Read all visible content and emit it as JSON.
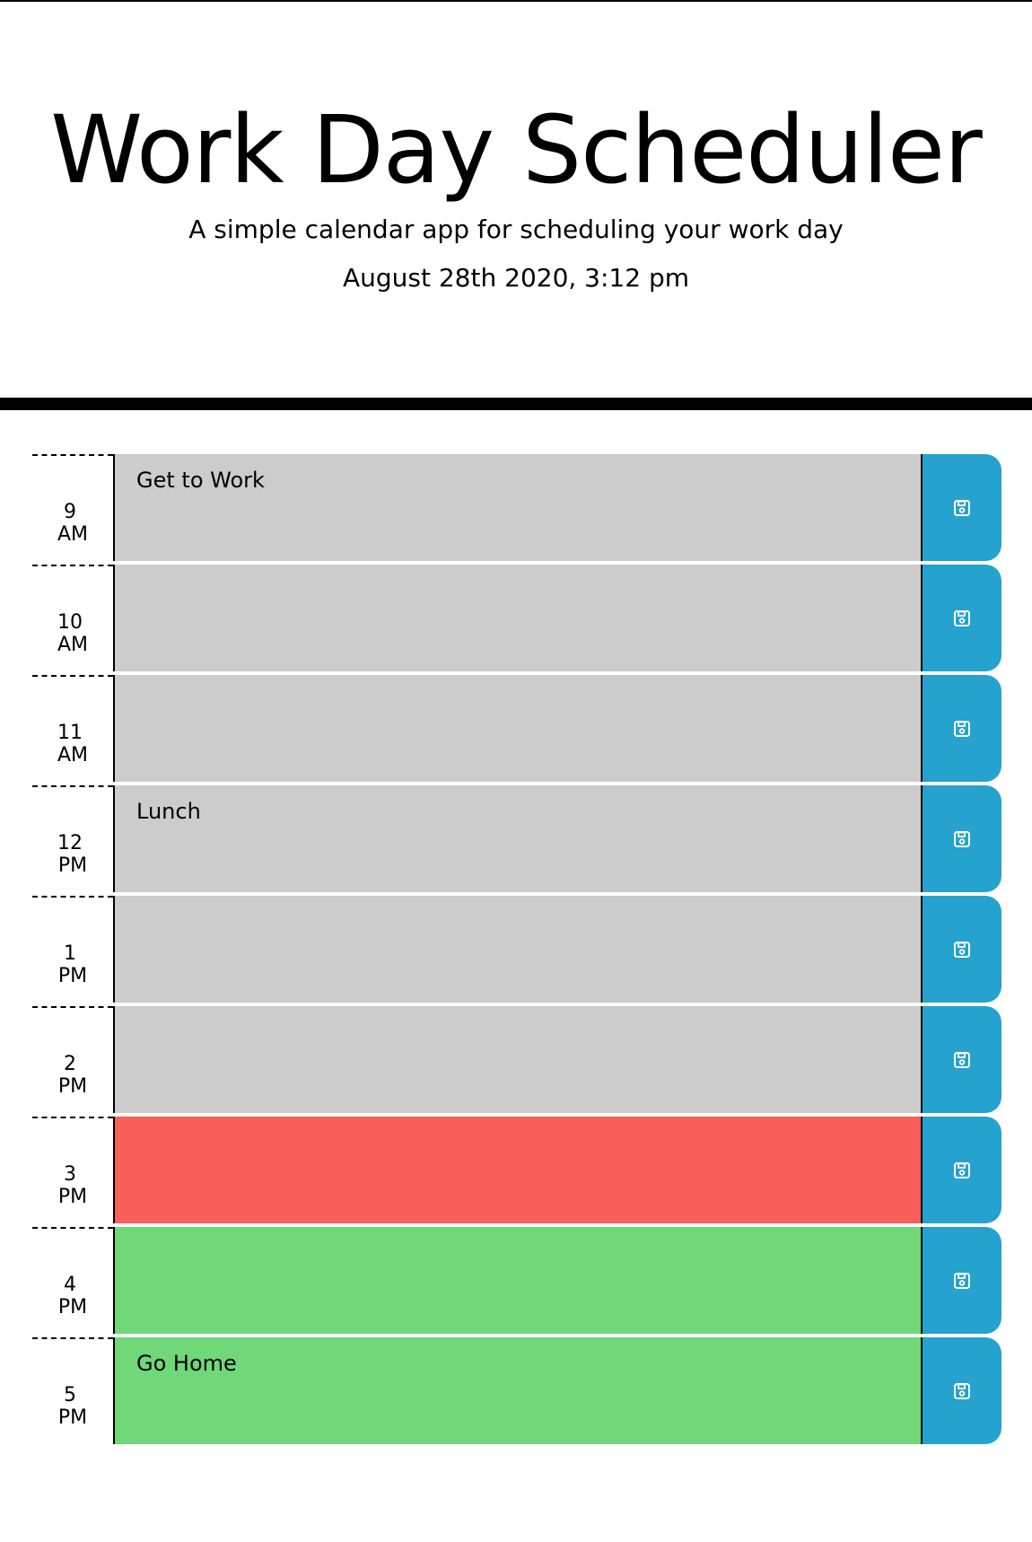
{
  "header": {
    "title": "Work Day Scheduler",
    "subtitle": "A simple calendar app for scheduling your work day",
    "current_day": "August 28th 2020, 3:12 pm"
  },
  "colors": {
    "past": "#cccccc",
    "present": "#f95f5a",
    "future": "#70d878",
    "save_button": "#25a2cd"
  },
  "save_icon": "save-icon",
  "timeblocks": [
    {
      "hour": "9",
      "period": "AM",
      "text": "Get to Work",
      "state": "past"
    },
    {
      "hour": "10",
      "period": "AM",
      "text": "",
      "state": "past"
    },
    {
      "hour": "11",
      "period": "AM",
      "text": "",
      "state": "past"
    },
    {
      "hour": "12",
      "period": "PM",
      "text": "Lunch",
      "state": "past"
    },
    {
      "hour": "1",
      "period": "PM",
      "text": "",
      "state": "past"
    },
    {
      "hour": "2",
      "period": "PM",
      "text": "",
      "state": "past"
    },
    {
      "hour": "3",
      "period": "PM",
      "text": "",
      "state": "present"
    },
    {
      "hour": "4",
      "period": "PM",
      "text": "",
      "state": "future"
    },
    {
      "hour": "5",
      "period": "PM",
      "text": "Go Home",
      "state": "future"
    }
  ]
}
